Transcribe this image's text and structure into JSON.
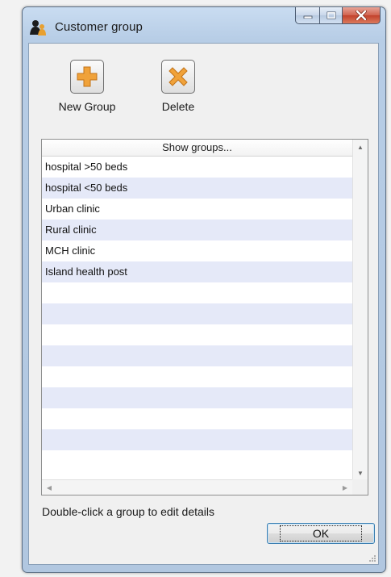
{
  "window": {
    "title": "Customer group",
    "caption_buttons": {
      "minimize": "minimize-icon",
      "maximize": "maximize-icon",
      "close": "close-icon"
    }
  },
  "toolbar": {
    "new_group_label": "New Group",
    "new_group_icon": "add-icon",
    "delete_label": "Delete",
    "delete_icon": "delete-icon",
    "accent_color": "#f0a23a"
  },
  "list": {
    "header": "Show groups...",
    "rows": [
      "hospital >50 beds",
      "hospital <50 beds",
      "Urban clinic",
      "Rural clinic",
      "MCH clinic",
      "Island health post",
      "",
      "",
      "",
      "",
      "",
      "",
      "",
      "",
      ""
    ]
  },
  "footer": {
    "hint": "Double-click a group to edit details",
    "ok_label": "OK"
  }
}
